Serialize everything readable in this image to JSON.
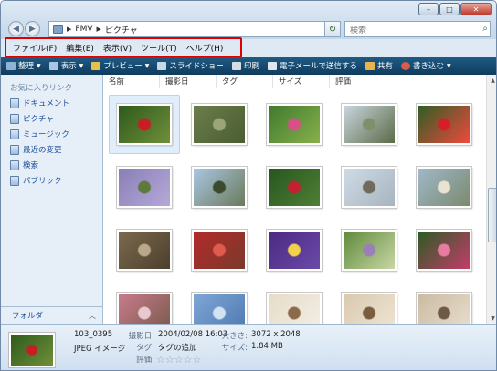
{
  "window": {
    "minimize": "–",
    "maximize": "□",
    "close": "✕"
  },
  "address": {
    "crumbs": [
      "FMV",
      "ピクチャ"
    ]
  },
  "search": {
    "placeholder": "検索"
  },
  "menu": [
    "ファイル(F)",
    "編集(E)",
    "表示(V)",
    "ツール(T)",
    "ヘルプ(H)"
  ],
  "toolbar": [
    {
      "label": "整理",
      "icon": "organize-icon",
      "dropdown": true
    },
    {
      "label": "表示",
      "icon": "views-icon",
      "dropdown": true
    },
    {
      "label": "プレビュー",
      "icon": "preview-icon",
      "dropdown": true
    },
    {
      "label": "スライドショー",
      "icon": "slideshow-icon",
      "dropdown": false
    },
    {
      "label": "印刷",
      "icon": "print-icon",
      "dropdown": false
    },
    {
      "label": "電子メールで送信する",
      "icon": "email-icon",
      "dropdown": false
    },
    {
      "label": "共有",
      "icon": "share-icon",
      "dropdown": false
    },
    {
      "label": "書き込む",
      "icon": "burn-icon",
      "dropdown": true
    }
  ],
  "sidebar": {
    "title": "お気に入りリンク",
    "items": [
      "ドキュメント",
      "ピクチャ",
      "ミュージック",
      "最近の変更",
      "検索",
      "パブリック"
    ],
    "folders": "フォルダ"
  },
  "columns": [
    "名前",
    "撮影日",
    "タグ",
    "サイズ",
    "評価"
  ],
  "thumbnails": [
    {
      "name": "red-flower-thumbnail",
      "colors": [
        "#2e5a1c",
        "#c81d25",
        "#6f8f3a"
      ]
    },
    {
      "name": "garden-thumbnail",
      "colors": [
        "#6b7d4a",
        "#9aa67a",
        "#4a5d33"
      ]
    },
    {
      "name": "pink-flowers-thumbnail",
      "colors": [
        "#3f7a2e",
        "#d94f8a",
        "#88b04b"
      ]
    },
    {
      "name": "bare-tree-thumbnail",
      "colors": [
        "#c9d6df",
        "#7e8f6a",
        "#5c6b47"
      ]
    },
    {
      "name": "red-dahlias-thumbnail",
      "colors": [
        "#2f5d24",
        "#d61e2b",
        "#f04a3c"
      ]
    },
    {
      "name": "purple-field-thumbnail",
      "colors": [
        "#8a7fb6",
        "#5e7a3a",
        "#b5a9d9"
      ]
    },
    {
      "name": "mountain-thumbnail",
      "colors": [
        "#a9c6e3",
        "#3b4a2c",
        "#6b7a5a"
      ]
    },
    {
      "name": "camellia-thumbnail",
      "colors": [
        "#27561f",
        "#c32032",
        "#4f7f35"
      ]
    },
    {
      "name": "winter-tree-thumbnail",
      "colors": [
        "#cfdbe6",
        "#6f6a5c",
        "#a7b3bd"
      ]
    },
    {
      "name": "pampas-grass-thumbnail",
      "colors": [
        "#9fb8c9",
        "#e9e3d2",
        "#7b8a6e"
      ]
    },
    {
      "name": "leaves-thumbnail",
      "colors": [
        "#7a6a4e",
        "#b9a98a",
        "#4c3f2c"
      ]
    },
    {
      "name": "red-blossoms-thumbnail",
      "colors": [
        "#b32a2a",
        "#e05b4d",
        "#7a3a2a"
      ]
    },
    {
      "name": "pansy-thumbnail",
      "colors": [
        "#4b2a82",
        "#f2d14b",
        "#6a4aa8"
      ]
    },
    {
      "name": "small-flower-thumbnail",
      "colors": [
        "#5d8a3a",
        "#9b7fb8",
        "#c8d6a4"
      ]
    },
    {
      "name": "pink-blossom-thumbnail",
      "colors": [
        "#2e5a24",
        "#e67ca0",
        "#c33d6a"
      ]
    },
    {
      "name": "blossom-closeup-thumbnail",
      "colors": [
        "#c77b8c",
        "#e8c9cf",
        "#7a5a4a"
      ]
    },
    {
      "name": "sky-thumbnail",
      "colors": [
        "#7ea6d6",
        "#d3e2f2",
        "#4f7ab0"
      ]
    },
    {
      "name": "cat-thumbnail",
      "colors": [
        "#e6dcc8",
        "#8a6a4a",
        "#f3efe6"
      ]
    },
    {
      "name": "kitten-thumbnail",
      "colors": [
        "#d9c9b0",
        "#7a5c3e",
        "#efe5d3"
      ]
    },
    {
      "name": "cat-portrait-thumbnail",
      "colors": [
        "#cbbba2",
        "#6e5a44",
        "#e8dfcf"
      ]
    }
  ],
  "details": {
    "filename": "103_0395",
    "filetype": "JPEG イメージ",
    "taken_label": "撮影日:",
    "taken_value": "2004/02/08 16:03",
    "tag_label": "タグ:",
    "tag_value": "タグの追加",
    "rating_label": "評価:",
    "size_label": "大きさ:",
    "size_value": "3072 x 2048",
    "filesize_label": "サイズ:",
    "filesize_value": "1.84 MB",
    "rating_stars": 0
  }
}
